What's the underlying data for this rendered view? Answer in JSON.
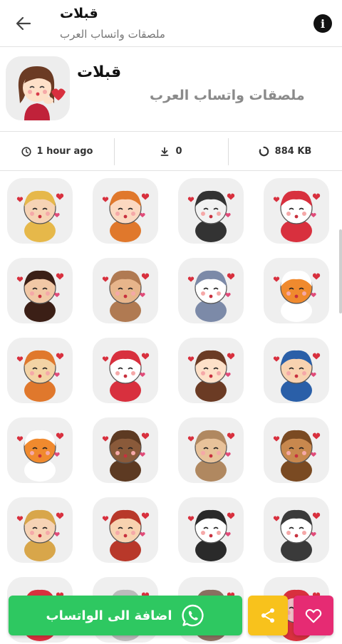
{
  "app_bar": {
    "title": "قبلات",
    "subtitle": "ملصقات واتساب العرب",
    "back_icon": "arrow-left-icon",
    "info_icon": "info-icon"
  },
  "pack": {
    "title": "قبلات",
    "publisher": "ملصقات واتساب العرب",
    "tray_icon": "girl-kiss-sticker"
  },
  "stats": {
    "updated": "1 hour ago",
    "downloads": "0",
    "size": "884 KB"
  },
  "stickers": [
    {
      "name": "ice-princess"
    },
    {
      "name": "redhead-girl-kiss"
    },
    {
      "name": "panda-girl-bat"
    },
    {
      "name": "seal-blowing-hearts"
    },
    {
      "name": "brunette-girl-kiss"
    },
    {
      "name": "bunny-girl-kiss"
    },
    {
      "name": "wolf-girl-kiss"
    },
    {
      "name": "fox-with-hearts"
    },
    {
      "name": "rooster-kiss"
    },
    {
      "name": "seal-with-hearts"
    },
    {
      "name": "girl-kiss"
    },
    {
      "name": "boy-with-hearts"
    },
    {
      "name": "fox-kiss"
    },
    {
      "name": "bear-kiss"
    },
    {
      "name": "chihuahua-with-hearts"
    },
    {
      "name": "reindeer-kiss"
    },
    {
      "name": "woman-blowing-kiss"
    },
    {
      "name": "girl-with-lollipop"
    },
    {
      "name": "panda-with-lips"
    },
    {
      "name": "husky-with-hearts"
    },
    {
      "name": "sticker-21"
    },
    {
      "name": "sticker-22"
    },
    {
      "name": "sticker-23"
    },
    {
      "name": "sticker-24"
    }
  ],
  "actions": {
    "add_to_whatsapp": "اضافة الى الواتساب",
    "share_icon": "share-icon",
    "favorite_icon": "heart-icon"
  },
  "colors": {
    "whatsapp_green": "#2ec861",
    "share_yellow": "#f8c21c",
    "favorite_pink": "#e62b73",
    "tile_bg": "#efefef"
  }
}
